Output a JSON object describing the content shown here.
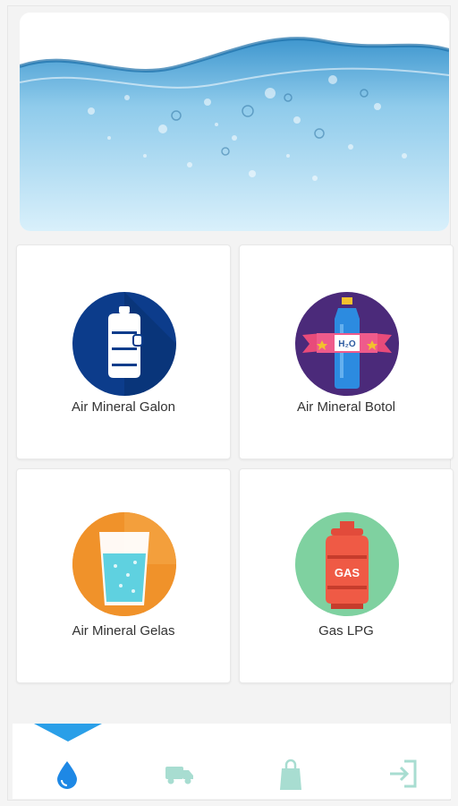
{
  "products": [
    {
      "label": "Air Mineral Galon",
      "icon": "water-gallon-icon",
      "color": "#0c3c8b"
    },
    {
      "label": "Air Mineral Botol",
      "icon": "water-bottle-icon",
      "color": "#4b2a7a"
    },
    {
      "label": "Air Mineral Gelas",
      "icon": "water-glass-icon",
      "color": "#f0922a"
    },
    {
      "label": "Gas LPG",
      "icon": "gas-cylinder-icon",
      "color": "#7fd1a0"
    }
  ],
  "bottom_nav": [
    {
      "icon": "water-drop-icon",
      "active": true,
      "color": "#1e88e5"
    },
    {
      "icon": "delivery-truck-icon",
      "active": false,
      "color": "#a8ddd1"
    },
    {
      "icon": "shopping-bag-icon",
      "active": false,
      "color": "#a8ddd1"
    },
    {
      "icon": "logout-icon",
      "active": false,
      "color": "#a8ddd1"
    }
  ],
  "badges": {
    "bottle_label": "H₂O",
    "gas_label": "GAS"
  }
}
